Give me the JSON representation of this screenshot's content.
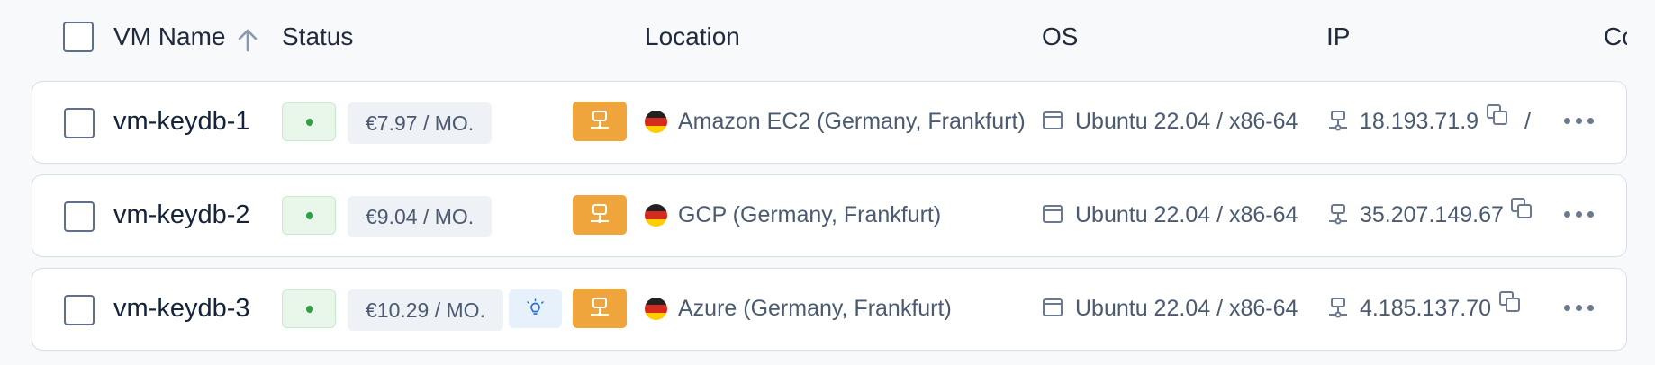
{
  "header": {
    "name": "VM Name",
    "status": "Status",
    "location": "Location",
    "os": "OS",
    "ip": "IP",
    "cost": "Co"
  },
  "rows": [
    {
      "name": "vm-keydb-1",
      "price": "€7.97 / MO.",
      "location": "Amazon EC2 (Germany, Frankfurt)",
      "os": "Ubuntu 22.04 / x86-64",
      "ip": "18.193.71.9",
      "extra": "/",
      "has_bulb": false
    },
    {
      "name": "vm-keydb-2",
      "price": "€9.04 / MO.",
      "location": "GCP (Germany, Frankfurt)",
      "os": "Ubuntu 22.04 / x86-64",
      "ip": "35.207.149.67",
      "has_bulb": false
    },
    {
      "name": "vm-keydb-3",
      "price": "€10.29 / MO.",
      "location": "Azure (Germany, Frankfurt)",
      "os": "Ubuntu 22.04 / x86-64",
      "ip": "4.185.137.70",
      "has_bulb": true
    }
  ],
  "colors": {
    "status_green": "#2f9e44",
    "server_badge": "#f0a43c",
    "bulb_bg": "#e6f1fb",
    "text_primary": "#15233a",
    "text_secondary": "#4a5a70"
  },
  "icons": {
    "sort": "arrow-up-icon",
    "server": "server-icon",
    "flag": "germany-flag-icon",
    "os": "window-icon",
    "network": "network-icon",
    "copy": "copy-icon",
    "more": "more-horizontal-icon",
    "bulb": "lightbulb-icon"
  }
}
